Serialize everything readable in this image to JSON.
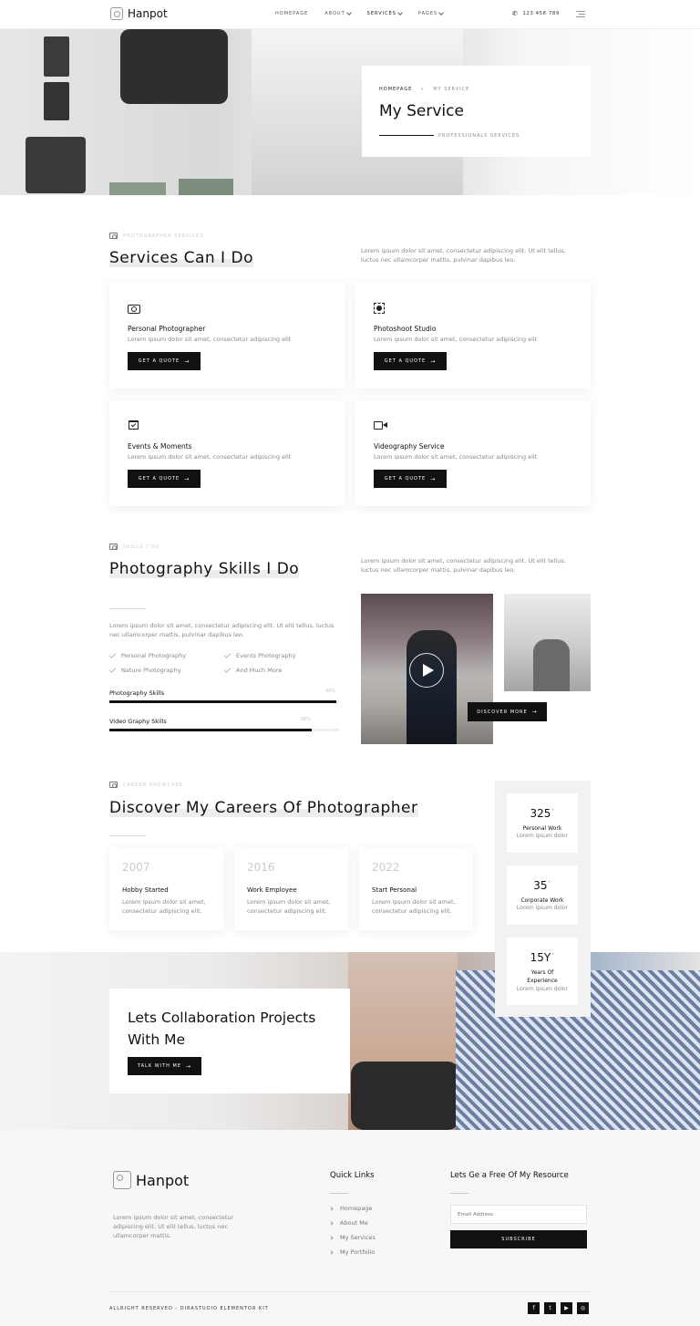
{
  "header": {
    "brand": "Hanpot",
    "nav": [
      {
        "label": "HOMEPAGE",
        "dropdown": false
      },
      {
        "label": "ABOUT",
        "dropdown": true
      },
      {
        "label": "SERVICES",
        "dropdown": true
      },
      {
        "label": "PAGES",
        "dropdown": true
      }
    ],
    "phone": "123 456 789"
  },
  "hero": {
    "breadcrumb_home": "HOMEPAGE",
    "breadcrumb_current": "MY SERVICE",
    "title": "My Service",
    "subtitle": "PROFESSIONALS SERVICES"
  },
  "services": {
    "tag": "PHOTOGRAPHER SERVICES",
    "title": "Services Can I Do",
    "description": "Lorem ipsum dolor sit amet, consectetur adipiscing elit. Ut elit tellus, luctus nec ullamcorper mattis, pulvinar dapibus leo.",
    "cards": [
      {
        "icon": "camera-icon",
        "title": "Personal Photographer",
        "text": "Lorem ipsum dolor sit amet, consectetur adipiscing elit",
        "button": "GET A QUOTE"
      },
      {
        "icon": "focus-icon",
        "title": "Photoshoot Studio",
        "text": "Lorem ipsum dolor sit amet, consectetur adipiscing elit",
        "button": "GET A QUOTE"
      },
      {
        "icon": "calendar-icon",
        "title": "Events & Moments",
        "text": "Lorem ipsum dolor sit amet, consectetur adipiscing elit",
        "button": "GET A QUOTE"
      },
      {
        "icon": "video-camera-icon",
        "title": "Videography Service",
        "text": "Lorem ipsum dolor sit amet, consectetur adipiscing elit",
        "button": "GET A QUOTE"
      }
    ]
  },
  "skills": {
    "tag": "SKILLS I DO",
    "title": "Photography Skills I Do",
    "description": "Lorem ipsum dolor sit amet, consectetur adipiscing elit. Ut elit tellus, luctus nec ullamcorper mattis, pulvinar dapibus leo.",
    "intro": "Lorem ipsum dolor sit amet, consectetur adipiscing elit. Ut elit tellus, luctus nec ullamcorper mattis, pulvinar dapibus leo.",
    "checklist": [
      "Personal Photography",
      "Events Photography",
      "Nature Photography",
      "And Much More"
    ],
    "bars": [
      {
        "label": "Photography Skills",
        "percent_label": "99%",
        "value": 99
      },
      {
        "label": "Video Graphy Skills",
        "percent_label": "88%",
        "value": 88
      }
    ],
    "discover_button": "DISCOVER MORE"
  },
  "careers": {
    "tag": "CAREER SHOWCASE",
    "title": "Discover My Careers Of Photographer",
    "items": [
      {
        "year": "2007",
        "title": "Hobby Started",
        "text": "Lorem ipsum dolor sit amet, consectetur adipiscing elit."
      },
      {
        "year": "2016",
        "title": "Work Employee",
        "text": "Lorem ipsum dolor sit amet, consectetur adipiscing elit."
      },
      {
        "year": "2022",
        "title": "Start Personal",
        "text": "Lorem ipsum dolor sit amet, consectetur adipiscing elit."
      }
    ],
    "stats": [
      {
        "number": "325",
        "sup": "+",
        "label": "Personal Work",
        "text": "Lorem ipsum dolor"
      },
      {
        "number": "35",
        "sup": "+",
        "label": "Corporate Work",
        "text": "Lorem ipsum dolor"
      },
      {
        "number": "15Y",
        "sup": "+",
        "label": "Years Of Experience",
        "text": "Lorem ipsum dolor"
      }
    ]
  },
  "collab": {
    "title": "Lets Collaboration Projects With Me",
    "button": "TALK WITH ME"
  },
  "footer": {
    "brand": "Hanpot",
    "about": "Lorem ipsum dolor sit amet, consectetur adipiscing elit. Ut elit tellus, luctus nec ullamcorper mattis.",
    "quick_links_title": "Quick Links",
    "links": [
      "Homepage",
      "About Me",
      "My Services",
      "My Portfolio"
    ],
    "newsletter_title": "Lets Ge a Free Of My Resource",
    "email_placeholder": "Email Address",
    "subscribe": "SUBSCRIBE",
    "copyright": "ALLRIGHT RESERVED - DIRASTUDIO ELEMENTOR KIT",
    "socials": [
      {
        "icon": "facebook-icon",
        "glyph": "f"
      },
      {
        "icon": "twitter-icon",
        "glyph": "t"
      },
      {
        "icon": "youtube-icon",
        "glyph": "▶"
      },
      {
        "icon": "instagram-icon",
        "glyph": "◎"
      }
    ]
  }
}
